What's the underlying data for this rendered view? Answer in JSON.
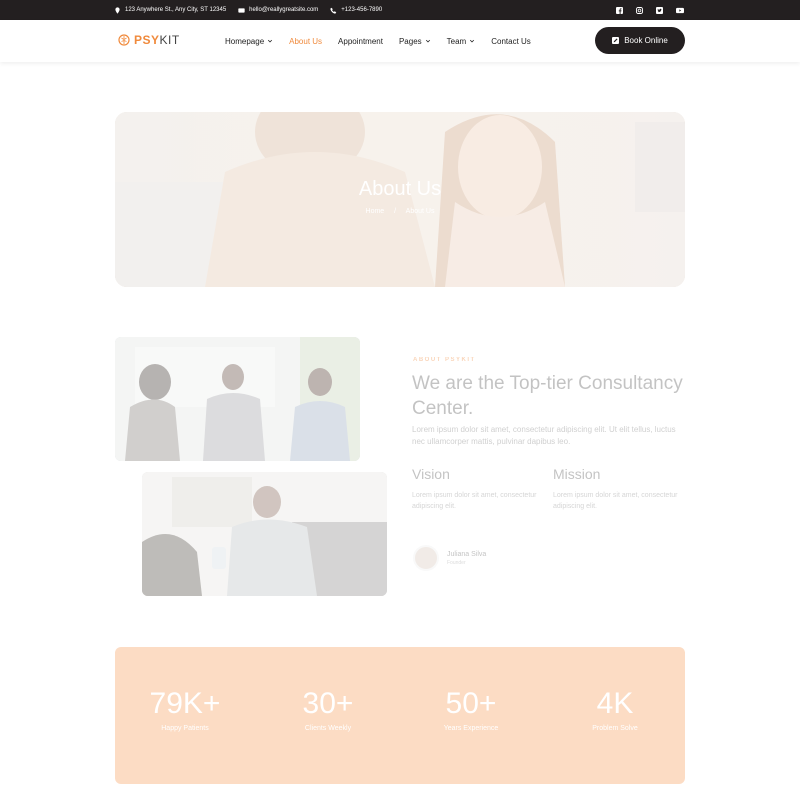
{
  "topbar": {
    "address": "123 Anywhere St., Any City, ST 12345",
    "email": "hello@reallygreatsite.com",
    "phone": "+123-456-7890",
    "social": [
      "facebook-icon",
      "instagram-icon",
      "twitter-icon",
      "youtube-icon"
    ]
  },
  "header": {
    "logo_part1": "PSY",
    "logo_part2": "KIT",
    "nav": [
      {
        "label": "Homepage",
        "dropdown": true
      },
      {
        "label": "About Us",
        "dropdown": false,
        "active": true
      },
      {
        "label": "Appointment",
        "dropdown": false
      },
      {
        "label": "Pages",
        "dropdown": true
      },
      {
        "label": "Team",
        "dropdown": true
      },
      {
        "label": "Contact Us",
        "dropdown": false
      }
    ],
    "cta": "Book Online"
  },
  "hero": {
    "title": "About Us",
    "crumb_home": "Home",
    "crumb_sep": "/",
    "crumb_current": "About Us"
  },
  "about": {
    "kicker": "ABOUT PSYKIT",
    "heading": "We are the Top-tier Consultancy Center.",
    "text": "Lorem ipsum dolor sit amet, consectetur adipiscing elit. Ut elit tellus, luctus nec ullamcorper mattis, pulvinar dapibus leo.",
    "vision_title": "Vision",
    "vision_text": "Lorem ipsum dolor sit amet, consectetur adipiscing elit.",
    "mission_title": "Mission",
    "mission_text": "Lorem ipsum dolor sit amet, consectetur adipiscing elit.",
    "author_name": "Juliana Silva",
    "author_role": "Founder"
  },
  "stats": [
    {
      "value": "79K+",
      "label": "Happy Patients"
    },
    {
      "value": "30+",
      "label": "Clients Weekly"
    },
    {
      "value": "50+",
      "label": "Years Experience"
    },
    {
      "value": "4K",
      "label": "Problem Solve"
    }
  ],
  "colors": {
    "accent": "#f08a3c",
    "dark": "#231f20",
    "stats_bg": "#fcdcc4"
  }
}
